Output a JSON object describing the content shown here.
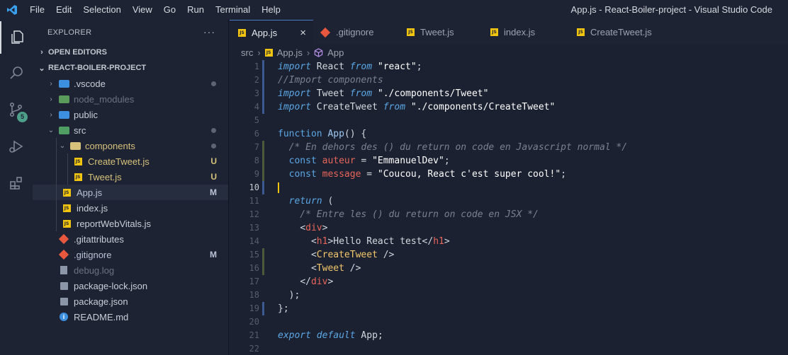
{
  "window": {
    "title": "App.js - React-Boiler-project - Visual Studio Code",
    "menu": [
      "File",
      "Edit",
      "Selection",
      "View",
      "Go",
      "Run",
      "Terminal",
      "Help"
    ]
  },
  "activity_bar": {
    "scm_badge": "5",
    "icons": [
      "explorer-icon",
      "search-icon",
      "source-control-icon",
      "run-debug-icon",
      "extensions-icon"
    ]
  },
  "explorer": {
    "header": "EXPLORER",
    "more": "···",
    "open_editors": "OPEN EDITORS",
    "project": "REACT-BOILER-PROJECT",
    "items": [
      {
        "label": ".vscode",
        "type": "folder",
        "status": "dot",
        "color": "#c9ced8"
      },
      {
        "label": "node_modules",
        "type": "folder",
        "status": "",
        "color": "#6b7281"
      },
      {
        "label": "public",
        "type": "folder",
        "status": "",
        "color": "#c9ced8"
      },
      {
        "label": "src",
        "type": "folder-open",
        "status": "dot",
        "color": "#c9ced8"
      },
      {
        "label": "components",
        "type": "folder-open",
        "status": "dot",
        "color": "#d6c27a"
      },
      {
        "label": "CreateTweet.js",
        "type": "js",
        "status": "U",
        "color": "#d6c27a"
      },
      {
        "label": "Tweet.js",
        "type": "js",
        "status": "U",
        "color": "#d6c27a"
      },
      {
        "label": "App.js",
        "type": "js",
        "status": "M",
        "color": "#b9c3d6"
      },
      {
        "label": "index.js",
        "type": "js",
        "status": "",
        "color": "#c9ced8"
      },
      {
        "label": "reportWebVitals.js",
        "type": "js",
        "status": "",
        "color": "#c9ced8"
      },
      {
        "label": ".gitattributes",
        "type": "git",
        "status": "",
        "color": "#c9ced8"
      },
      {
        "label": ".gitignore",
        "type": "git",
        "status": "M",
        "color": "#b9c3d6"
      },
      {
        "label": "debug.log",
        "type": "log",
        "status": "",
        "color": "#6b7281"
      },
      {
        "label": "package-lock.json",
        "type": "npm",
        "status": "",
        "color": "#c9ced8"
      },
      {
        "label": "package.json",
        "type": "npm",
        "status": "",
        "color": "#c9ced8"
      },
      {
        "label": "README.md",
        "type": "info",
        "status": "",
        "color": "#c9ced8"
      }
    ]
  },
  "tabs": [
    {
      "label": "App.js",
      "icon": "js",
      "active": true
    },
    {
      "label": ".gitignore",
      "icon": "git",
      "active": false
    },
    {
      "label": "Tweet.js",
      "icon": "js",
      "active": false
    },
    {
      "label": "index.js",
      "icon": "js",
      "active": false
    },
    {
      "label": "CreateTweet.js",
      "icon": "js",
      "active": false
    }
  ],
  "breadcrumb": [
    "src",
    "App.js",
    "App"
  ],
  "code": {
    "current_line": 10,
    "lines": [
      "import React from \"react\";",
      "//Import components",
      "import Tweet from \"./components/Tweet\"",
      "import CreateTweet from \"./components/CreateTweet\"",
      "",
      "function App() {",
      "  /* En dehors des () du return on code en Javascript normal */",
      "  const auteur = \"EmmanuelDev\";",
      "  const message = \"Coucou, React c'est super cool!\";",
      "",
      "  return (",
      "    /* Entre les () du return on code en JSX */",
      "    <div>",
      "      <h1>Hello React test</h1>",
      "      <CreateTweet />",
      "      <Tweet />",
      "    </div>",
      "  );",
      "};",
      "",
      "export default App;",
      ""
    ]
  },
  "colors": {
    "background": "#1b2130",
    "sidebar": "#1d2333",
    "accent": "#4a7ac4",
    "git_added": "#4fa08b"
  }
}
